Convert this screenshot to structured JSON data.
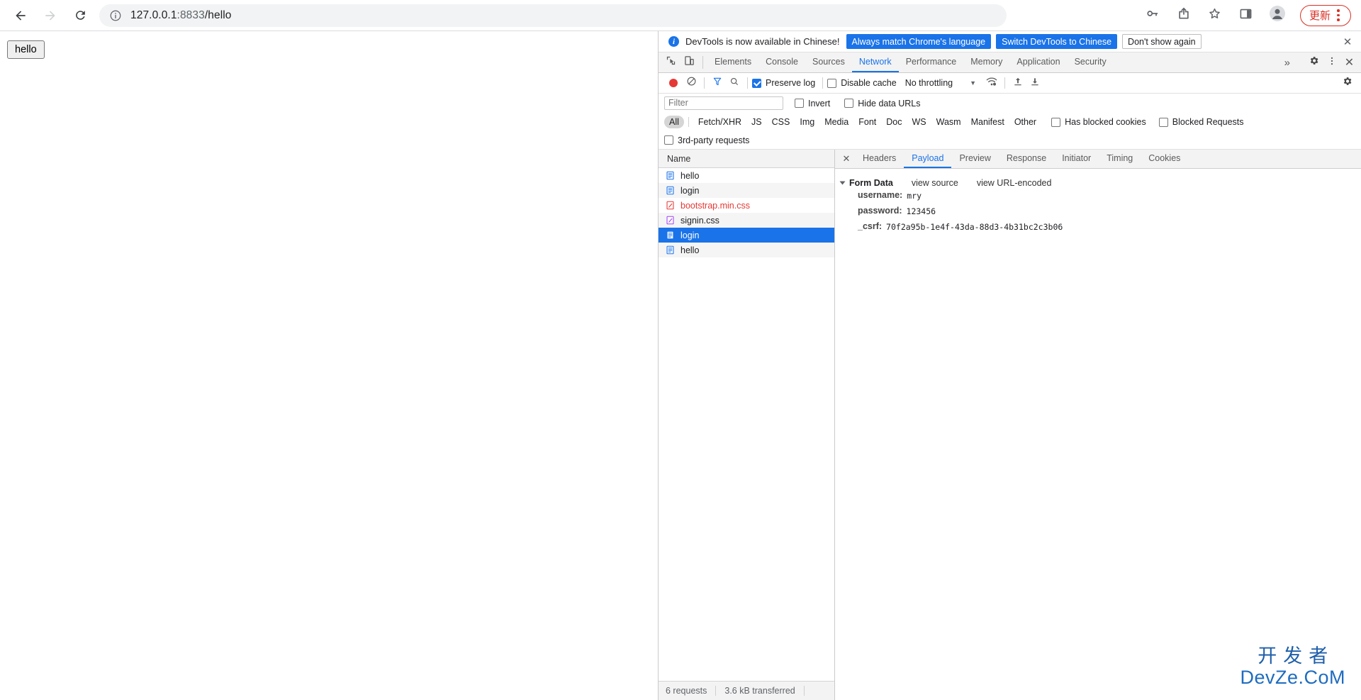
{
  "browser": {
    "back_icon": "back-arrow-icon",
    "forward_icon": "forward-arrow-icon",
    "reload_icon": "reload-icon",
    "site_info_icon": "info-circle-icon",
    "url_host": "127.0.0.1",
    "url_port": ":8833",
    "url_path": "/hello",
    "right_icons": [
      "password-key-icon",
      "share-icon",
      "bookmark-star-icon",
      "side-panel-icon",
      "profile-avatar-icon"
    ],
    "update_label": "更新",
    "update_color": "#d93025",
    "menu_icon": "kebab-menu-icon"
  },
  "page": {
    "hello_button": "hello"
  },
  "devtools": {
    "banner": {
      "info_icon": "info-icon",
      "text": "DevTools is now available in Chinese!",
      "primary_buttons": [
        "Always match Chrome's language",
        "Switch DevTools to Chinese"
      ],
      "secondary_button": "Don't show again",
      "close_icon": "close-icon",
      "accent": "#1a73e8"
    },
    "tabs": {
      "inspect_icon": "inspect-element-icon",
      "device_icon": "device-toolbar-icon",
      "items": [
        {
          "label": "Elements",
          "active": false
        },
        {
          "label": "Console",
          "active": false
        },
        {
          "label": "Sources",
          "active": false
        },
        {
          "label": "Network",
          "active": true
        },
        {
          "label": "Performance",
          "active": false
        },
        {
          "label": "Memory",
          "active": false
        },
        {
          "label": "Application",
          "active": false
        },
        {
          "label": "Security",
          "active": false
        }
      ],
      "more_label": "»",
      "settings_icon": "gear-icon",
      "kebab_icon": "kebab-menu-icon",
      "close_icon": "close-icon"
    },
    "network_toolbar": {
      "record_icon": "record-button-icon",
      "clear_icon": "clear-icon",
      "filter_icon": "filter-funnel-icon",
      "search_icon": "search-icon",
      "preserve_log": {
        "label": "Preserve log",
        "checked": true
      },
      "disable_cache": {
        "label": "Disable cache",
        "checked": false
      },
      "throttling": "No throttling",
      "throttling_caret": "▼",
      "wifi_icon": "network-conditions-icon",
      "import_icon": "import-har-icon",
      "export_icon": "export-har-icon",
      "settings_icon": "gear-icon"
    },
    "filter_row": {
      "filter_placeholder": "Filter",
      "filter_value": "",
      "invert": {
        "label": "Invert",
        "checked": false
      },
      "hide_data_urls": {
        "label": "Hide data URLs",
        "checked": false
      }
    },
    "type_filters": {
      "chips": [
        "All",
        "Fetch/XHR",
        "JS",
        "CSS",
        "Img",
        "Media",
        "Font",
        "Doc",
        "WS",
        "Wasm",
        "Manifest",
        "Other"
      ],
      "active_chip": "All",
      "has_blocked_cookies": {
        "label": "Has blocked cookies",
        "checked": false
      },
      "blocked_requests": {
        "label": "Blocked Requests",
        "checked": false
      },
      "third_party": {
        "label": "3rd-party requests",
        "checked": false
      }
    },
    "request_list": {
      "column_header": "Name",
      "rows": [
        {
          "name": "hello",
          "type": "doc",
          "selected": false,
          "error": false
        },
        {
          "name": "login",
          "type": "doc",
          "selected": false,
          "error": false
        },
        {
          "name": "bootstrap.min.css",
          "type": "css-error",
          "selected": false,
          "error": true
        },
        {
          "name": "signin.css",
          "type": "css",
          "selected": false,
          "error": false
        },
        {
          "name": "login",
          "type": "doc",
          "selected": true,
          "error": false
        },
        {
          "name": "hello",
          "type": "doc",
          "selected": false,
          "error": false
        }
      ],
      "status_requests": "6 requests",
      "status_transferred": "3.6 kB transferred"
    },
    "detail": {
      "close_icon": "close-icon",
      "tabs": [
        {
          "label": "Headers",
          "active": false
        },
        {
          "label": "Payload",
          "active": true
        },
        {
          "label": "Preview",
          "active": false
        },
        {
          "label": "Response",
          "active": false
        },
        {
          "label": "Initiator",
          "active": false
        },
        {
          "label": "Timing",
          "active": false
        },
        {
          "label": "Cookies",
          "active": false
        }
      ],
      "payload": {
        "section_title": "Form Data",
        "view_source_label": "view source",
        "view_url_encoded_label": "view URL-encoded",
        "fields": [
          {
            "key": "username:",
            "value": "mry"
          },
          {
            "key": "password:",
            "value": "123456"
          },
          {
            "key": "_csrf:",
            "value": "70f2a95b-1e4f-43da-88d3-4b31bc2c3b06"
          }
        ]
      }
    }
  },
  "watermark": {
    "chinese": "开发者",
    "english": "DevZe.CoM",
    "color": "#1f6cc0"
  }
}
